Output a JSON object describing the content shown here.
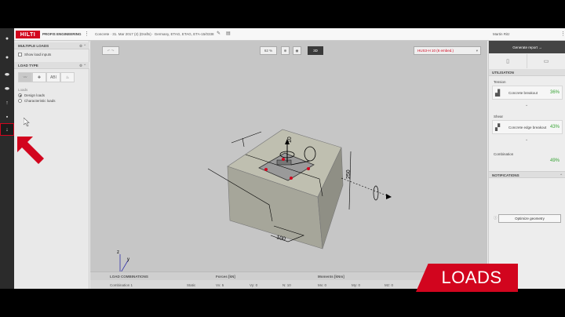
{
  "brand": {
    "logo": "HILTI",
    "product": "PROFIS ENGINEERING"
  },
  "project": {
    "title": "Concrete · 31. Mar 2017 (2) (Drafts) · Germany, ETAG, ETAG, ETA-15/0338"
  },
  "user": {
    "name": "Martin Ritz"
  },
  "left_rail": [
    {
      "icon": "home-icon"
    },
    {
      "icon": "concrete-icon"
    },
    {
      "icon": "baseplate-icon"
    },
    {
      "icon": "profile-icon"
    },
    {
      "icon": "anchor-icon"
    },
    {
      "icon": "calculator-icon"
    },
    {
      "icon": "loads-icon",
      "active": true
    }
  ],
  "multiple_loads": {
    "title": "MULTIPLE LOADS",
    "show_inputs_label": "Show load inputs"
  },
  "load_type": {
    "title": "LOAD TYPE",
    "buttons": [
      "static-load-icon",
      "seismic-load-icon",
      "fatigue-load-icon",
      "fire-load-icon"
    ],
    "seismic_label": "ABI",
    "loads_caption": "Loads",
    "options": [
      {
        "label": "Design loads",
        "selected": true
      },
      {
        "label": "Characteristic loads",
        "selected": false
      }
    ]
  },
  "toolbar": {
    "zoom": "62 %",
    "mode": "3D",
    "anchor_select": "HUS3-H 10 (6 embed.)"
  },
  "model": {
    "dim_top": "10",
    "dim_right": "250",
    "dim_front": "100",
    "axes": [
      "x",
      "y",
      "z"
    ]
  },
  "load_combinations": {
    "headers": {
      "title": "LOAD COMBINATIONS",
      "forces": "Forces [kN]",
      "moments": "Moments [kNm]"
    },
    "row": {
      "name": "Combination 1",
      "type": "Static",
      "vx": "Vx: 5",
      "vy": "Vy: 0",
      "n": "N: 10",
      "mx": "Mx: 0",
      "my": "My: 0",
      "mz": "Mz: 0"
    }
  },
  "right_panel": {
    "generate_label": "Generate report",
    "utilisation_title": "UTILISATION",
    "tension_label": "Tension",
    "tension_check": "Concrete breakout",
    "tension_value": "36%",
    "shear_label": "Shear",
    "shear_check": "Concrete edge breakout",
    "shear_value": "43%",
    "combination_label": "Combination",
    "combination_value": "49%",
    "notifications_title": "NOTIFICATIONS",
    "optimize_label": "Optimize geometry"
  },
  "overlay": {
    "label": "LOADS"
  },
  "colors": {
    "brand_red": "#d2051e",
    "success_green": "#38a335",
    "rail": "#2b2b2b"
  }
}
